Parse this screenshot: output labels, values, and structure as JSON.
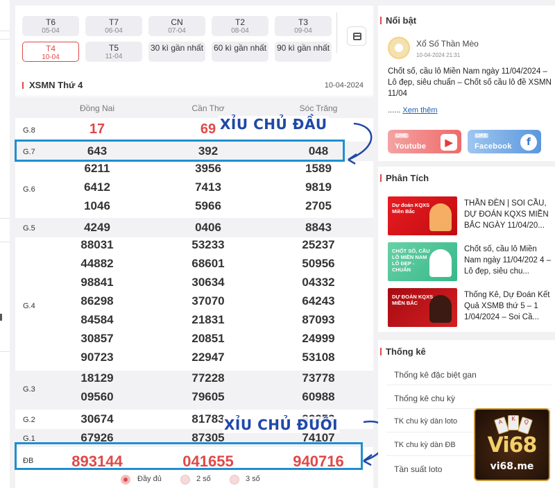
{
  "days": [
    {
      "label": "T6",
      "date": "05-04"
    },
    {
      "label": "T7",
      "date": "06-04"
    },
    {
      "label": "CN",
      "date": "07-04"
    },
    {
      "label": "T2",
      "date": "08-04"
    },
    {
      "label": "T3",
      "date": "09-04"
    },
    {
      "label": "T4",
      "date": "10-04"
    },
    {
      "label": "T5",
      "date": "11-04"
    }
  ],
  "ranges": [
    "30 kì gần nhất",
    "60 kì gần nhất",
    "90 kì gần nhất"
  ],
  "result": {
    "title": "XSMN Thứ 4",
    "date": "10-04-2024",
    "provinces": [
      "Đồng Nai",
      "Cần Thơ",
      "Sóc Trăng"
    ],
    "g8": [
      "17",
      "69",
      ""
    ],
    "g7": [
      "643",
      "392",
      "048"
    ],
    "g6": [
      [
        "6211",
        "3956",
        "1589"
      ],
      [
        "6412",
        "7413",
        "9819"
      ],
      [
        "1046",
        "5966",
        "2705"
      ]
    ],
    "g5": [
      "4249",
      "0406",
      "8843"
    ],
    "g4": [
      [
        "88031",
        "53233",
        "25237"
      ],
      [
        "44882",
        "68601",
        "50956"
      ],
      [
        "98841",
        "30634",
        "04332"
      ],
      [
        "86298",
        "37070",
        "64243"
      ],
      [
        "84584",
        "21831",
        "87093"
      ],
      [
        "30857",
        "20851",
        "24999"
      ],
      [
        "90723",
        "22947",
        "53108"
      ]
    ],
    "g3": [
      [
        "18129",
        "77228",
        "73778"
      ],
      [
        "09560",
        "79605",
        "60988"
      ]
    ],
    "g2": [
      "30674",
      "81783",
      "92252"
    ],
    "g1": [
      "67926",
      "87305",
      "74107"
    ],
    "db": [
      "893144",
      "041655",
      "940716"
    ],
    "labels": {
      "g8": "G.8",
      "g7": "G.7",
      "g6": "G.6",
      "g5": "G.5",
      "g4": "G.4",
      "g3": "G.3",
      "g2": "G.2",
      "g1": "G.1",
      "db": "ĐB"
    }
  },
  "annotations": {
    "top": "XỈU CHỦ ĐẦU",
    "bottom": "XỈU CHỦ ĐUÔI"
  },
  "options": [
    "Đầy đủ",
    "2 số",
    "3 số"
  ],
  "sidebar": {
    "featured": {
      "heading": "Nổi bật",
      "author": "Xổ Số Thần Mèo",
      "time": "10-04-2024 21:31",
      "text": "Chốt số, cầu lô Miền Nam ngày 11/04/2024 – Lô đẹp, siêu chuẩn – Chốt số cầu lô đề XSMN 11/04",
      "more_prefix": "......",
      "more": "Xem thêm"
    },
    "social": [
      {
        "live": "LIVE",
        "label": "Youtube",
        "logo": "▶"
      },
      {
        "live": "LIKE",
        "label": "Facebook",
        "logo": "f"
      }
    ],
    "analysis": {
      "heading": "Phân Tích",
      "items": [
        {
          "thumb": "Dự đoán KQXS Miền Bắc",
          "text": "THẦN ĐÈN | SOI CẦU, DỰ ĐOÁN KQXS MIỀN BẮC NGÀY 11/04/20..."
        },
        {
          "thumb": "CHỐT SỐ, CẦU LÔ MIỀN NAM LÔ ĐẸP - CHUẨN",
          "text": "Chốt số, cầu lô Miền Nam ngày 11/04/202 4 – Lô đẹp, siêu chu..."
        },
        {
          "thumb": "DỰ ĐOÁN KQXS MIỀN BẮC",
          "text": "Thống Kê, Dự Đoán Kết Quả XSMB thứ 5 – 1 1/04/2024 – Soi Cầ..."
        }
      ]
    },
    "stats": {
      "heading": "Thống kê",
      "links": [
        "Thống kê đặc biệt gan",
        "Thống kê chu kỳ",
        "TK chu kỳ dàn loto",
        "TK chu kỳ dàn ĐB",
        "Tần suất loto"
      ]
    }
  },
  "watermark": {
    "brand": "Vi68",
    "url": "vi68.me",
    "cards": [
      "A",
      "K",
      "Q"
    ]
  }
}
